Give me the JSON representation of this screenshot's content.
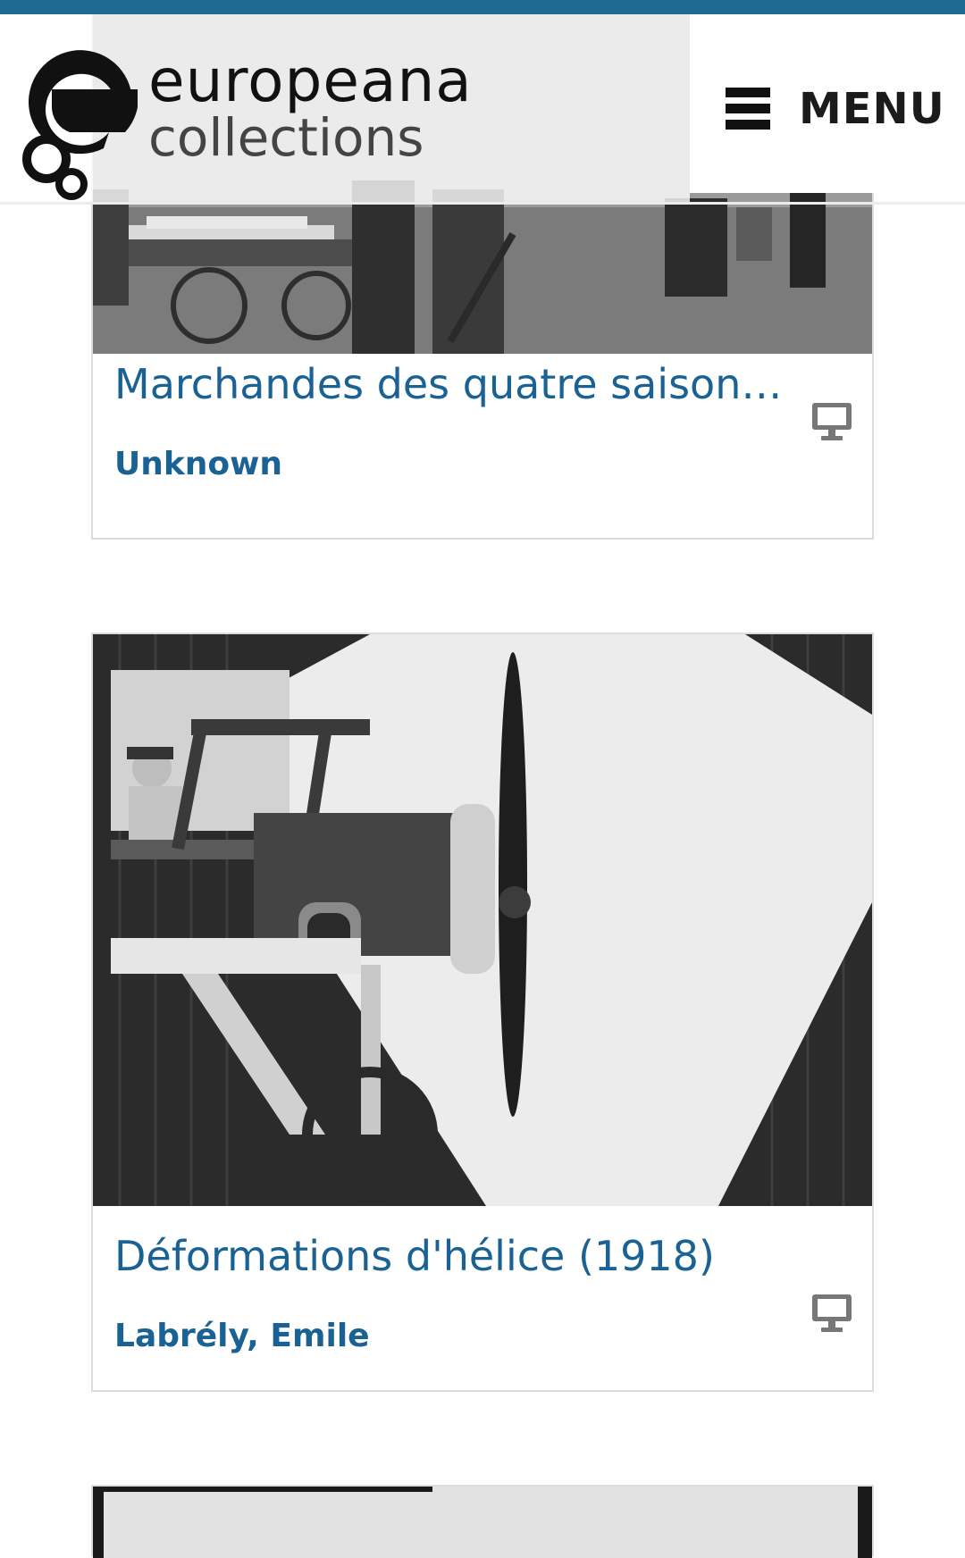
{
  "header": {
    "logo_line1": "europeana",
    "logo_line2": "collections",
    "menu_label": "MENU"
  },
  "results": [
    {
      "title": "Marchandes des quatre saisons (…",
      "creator": "Unknown",
      "media_type_icon": "monitor-icon"
    },
    {
      "title": "Déformations d'hélice (1918)",
      "creator": "Labrély, Emile",
      "media_type_icon": "monitor-icon"
    },
    {
      "title": "",
      "creator": "",
      "media_type_icon": ""
    }
  ],
  "colors": {
    "accent": "#1f6a93",
    "link": "#1a6294",
    "card_border": "#dcdcdc"
  }
}
